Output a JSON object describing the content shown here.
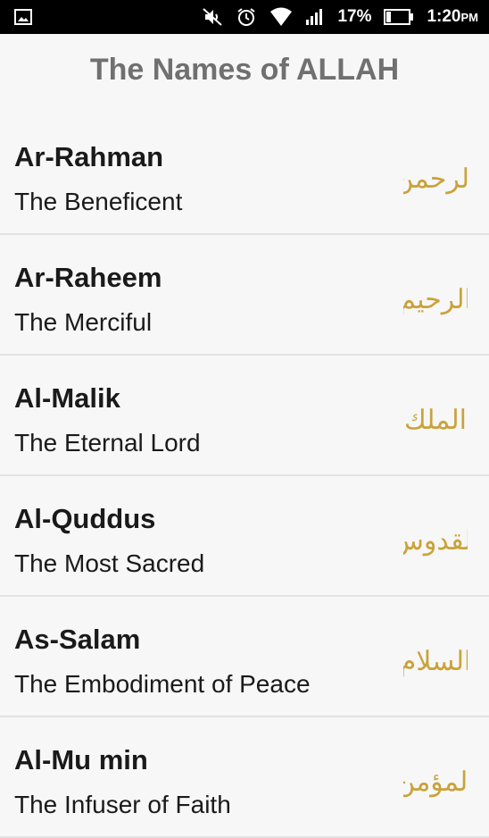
{
  "status_bar": {
    "battery_percent": "17%",
    "time": "1:20",
    "time_suffix": "PM"
  },
  "header": {
    "title": "The Names of ALLAH"
  },
  "names": [
    {
      "name": "Ar-Rahman",
      "meaning": "The Beneficent",
      "arabic": "الرحمن"
    },
    {
      "name": "Ar-Raheem",
      "meaning": "The Merciful",
      "arabic": "الرحيم"
    },
    {
      "name": "Al-Malik",
      "meaning": "The Eternal Lord",
      "arabic": "الملك"
    },
    {
      "name": "Al-Quddus",
      "meaning": "The Most Sacred",
      "arabic": "القدوس"
    },
    {
      "name": "As-Salam",
      "meaning": "The Embodiment of Peace",
      "arabic": "السلام"
    },
    {
      "name": "Al-Mu min",
      "meaning": "The Infuser of Faith",
      "arabic": "المؤمن"
    }
  ],
  "colors": {
    "gold": "#c9a23a",
    "title_gray": "#707070"
  },
  "icons": [
    "image-notification-icon",
    "mute-icon",
    "alarm-icon",
    "wifi-icon",
    "signal-icon",
    "battery-icon"
  ]
}
